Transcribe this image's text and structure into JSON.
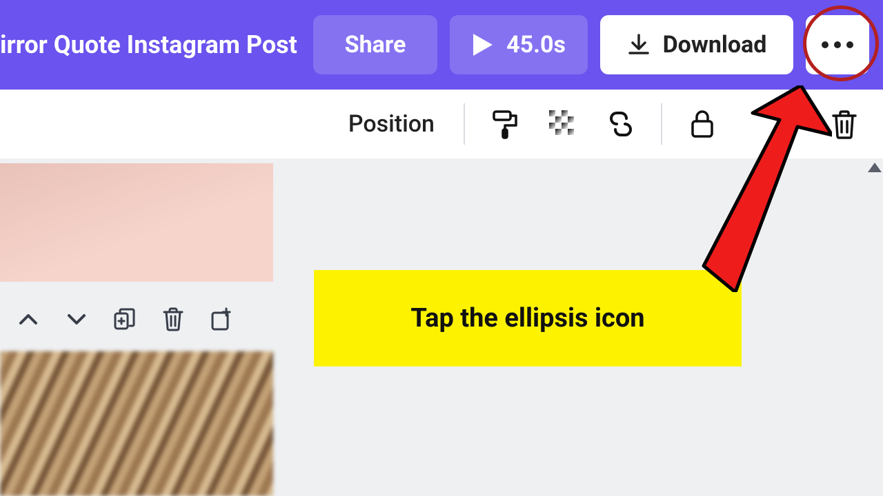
{
  "header": {
    "title": "irror Quote Instagram Post",
    "share_label": "Share",
    "play_duration": "45.0s",
    "download_label": "Download"
  },
  "toolbar2": {
    "position_label": "Position"
  },
  "callout": {
    "text": "Tap the ellipsis icon"
  }
}
